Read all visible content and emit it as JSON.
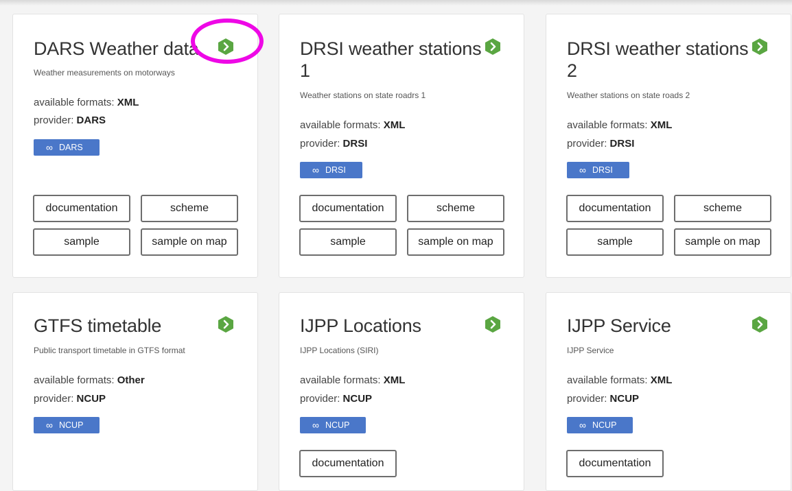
{
  "cards": [
    {
      "title": "DARS Weather data",
      "description": "Weather measurements on motorways",
      "formats_label": "available formats: ",
      "formats_value": "XML",
      "provider_label": "provider: ",
      "provider_value": "DARS",
      "link_label": "DARS",
      "buttons": [
        "documentation",
        "scheme",
        "sample",
        "sample on map"
      ]
    },
    {
      "title": "DRSI weather stations 1",
      "description": "Weather stations on state roadrs 1",
      "formats_label": "available formats: ",
      "formats_value": "XML",
      "provider_label": "provider: ",
      "provider_value": "DRSI",
      "link_label": "DRSI",
      "buttons": [
        "documentation",
        "scheme",
        "sample",
        "sample on map"
      ]
    },
    {
      "title": "DRSI weather stations 2",
      "description": "Weather stations on state roads 2",
      "formats_label": "available formats: ",
      "formats_value": "XML",
      "provider_label": "provider: ",
      "provider_value": "DRSI",
      "link_label": "DRSI",
      "buttons": [
        "documentation",
        "scheme",
        "sample",
        "sample on map"
      ]
    },
    {
      "title": "GTFS timetable",
      "description": "Public transport timetable in GTFS format",
      "formats_label": "available formats: ",
      "formats_value": "Other",
      "provider_label": "provider: ",
      "provider_value": "NCUP",
      "link_label": "NCUP",
      "buttons": []
    },
    {
      "title": "IJPP Locations",
      "description": "IJPP Locations (SIRI)",
      "formats_label": "available formats: ",
      "formats_value": "XML",
      "provider_label": "provider: ",
      "provider_value": "NCUP",
      "link_label": "NCUP",
      "buttons": [
        "documentation"
      ]
    },
    {
      "title": "IJPP Service",
      "description": "IJPP Service",
      "formats_label": "available formats: ",
      "formats_value": "XML",
      "provider_label": "provider: ",
      "provider_value": "NCUP",
      "link_label": "NCUP",
      "buttons": [
        "documentation"
      ]
    }
  ],
  "icons": {
    "go": "chevron-right-hexagon-icon",
    "link": "link-icon"
  },
  "colors": {
    "go_green": "#5aa642",
    "link_blue": "#4a77c9",
    "annotation_magenta": "#ee08e6"
  }
}
